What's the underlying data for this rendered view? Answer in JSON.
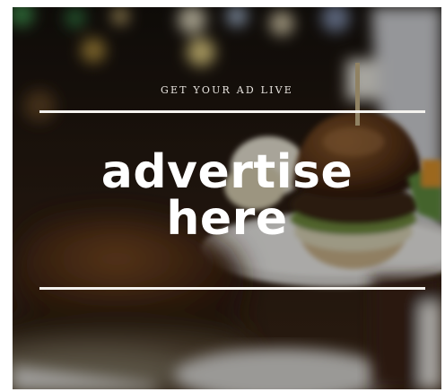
{
  "ad": {
    "tagline": "GET YOUR AD LIVE",
    "headline_line1": "advertise",
    "headline_line2": "here"
  },
  "colors": {
    "text": "#ffffff",
    "rule": "#f4f2ee",
    "background_photo_tone": "#3a2414"
  },
  "image": {
    "subject": "burger-photo"
  }
}
